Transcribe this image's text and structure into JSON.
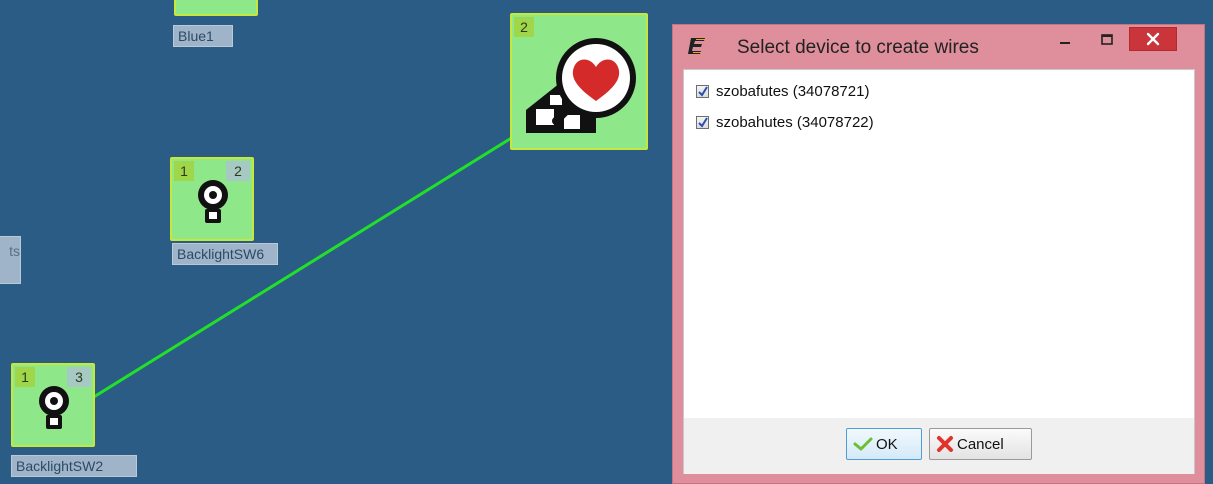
{
  "canvas": {
    "nodes": {
      "blue1": {
        "label": "Blue1"
      },
      "heart_home": {
        "badge_left": "2"
      },
      "backlight_sw6": {
        "badge_left": "1",
        "badge_right": "2",
        "label": "BacklightSW6"
      },
      "backlight_sw2": {
        "badge_left": "1",
        "badge_right": "3",
        "label": "BacklightSW2"
      },
      "partial_left": {
        "label": "ts"
      }
    },
    "wire_color": "#22e02a"
  },
  "dialog": {
    "title": "Select device to create wires",
    "app_icon": "ease-logo-icon",
    "items": [
      {
        "label": "szobafutes (34078721)",
        "checked": true
      },
      {
        "label": "szobahutes (34078722)",
        "checked": true
      }
    ],
    "buttons": {
      "ok": "OK",
      "cancel": "Cancel"
    },
    "colors": {
      "frame": "#de8f9b",
      "close": "#c9353b"
    }
  }
}
